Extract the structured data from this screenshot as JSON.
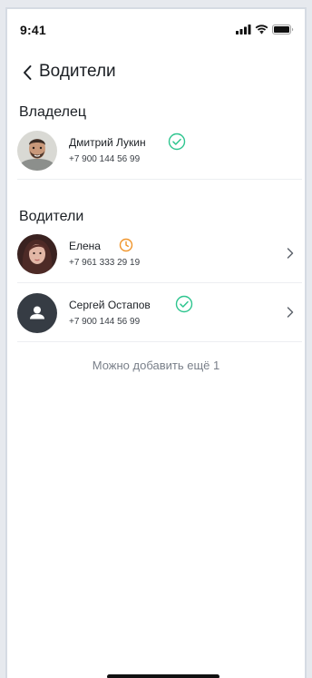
{
  "status_bar": {
    "time": "9:41"
  },
  "nav": {
    "title": "Водители",
    "back_icon": "chevron-left-icon"
  },
  "owner_section": {
    "title": "Владелец",
    "items": [
      {
        "name": "Дмитрий Лукин",
        "phone": "+7 900 144 56 99",
        "status": "confirmed",
        "status_icon": "check-circle-icon",
        "status_color": "#2ec58f",
        "avatar": "photo"
      }
    ]
  },
  "drivers_section": {
    "title": "Водители",
    "items": [
      {
        "name": "Елена",
        "phone": "+7 961 333 29 19",
        "status": "pending",
        "status_icon": "clock-icon",
        "status_color": "#f0952b",
        "avatar": "photo"
      },
      {
        "name": "Сергей Остапов",
        "phone": "+7 900 144 56 99",
        "status": "confirmed",
        "status_icon": "check-circle-icon",
        "status_color": "#2ec58f",
        "avatar": "placeholder"
      }
    ]
  },
  "footer": {
    "note": "Можно добавить ещё 1"
  },
  "colors": {
    "accent_green": "#2ec58f",
    "accent_orange": "#f0952b",
    "placeholder_avatar": "#363c44"
  }
}
